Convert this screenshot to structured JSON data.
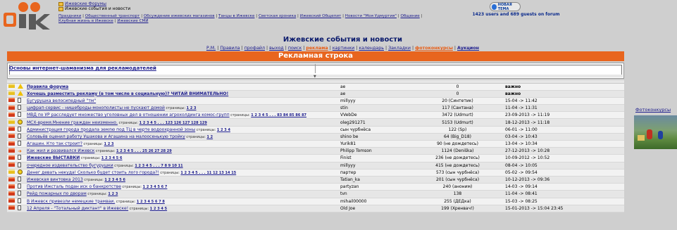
{
  "header": {
    "crumb_forum": "Ижевские Форумы",
    "crumb_section": "Ижевские события и новости",
    "new_topic": "НОВАЯ ТЕМА",
    "online": "1423 users and 689 guests on forum",
    "topnav": [
      "Праздники",
      "Общественный транспорт",
      "Обсуждение ижевских магазинов",
      "Танцы в Ижевске",
      "Светская хроника",
      "Ижевский Общепит",
      "Новости \"Моя Удмуртия\"",
      "Общение",
      "Клубная жизнь в Ижевске",
      "Ижевские СМИ"
    ]
  },
  "page_title": "Ижевские события и новости",
  "menu": {
    "items": [
      "Р.М.",
      "Правила",
      "профайл",
      "выход",
      "поиск",
      "реклама",
      "картинки",
      "календарь",
      "Закладки",
      "фотоконкурсы",
      "Аукцион"
    ]
  },
  "ad_bar": "Рекламная строка",
  "ad_box_title": "Основы интернет-шаманизма для рекламодателей",
  "pages_word": "страницы:",
  "topics": [
    {
      "icon": "warn",
      "title": "Правила форума",
      "bold": true,
      "pages": "",
      "author": "ae",
      "replies": "0",
      "last": "важно"
    },
    {
      "icon": "warn",
      "title": "Хочешь разместить рекламу (в том числе в социальную)? ЧИТАЙ ВНИМАТЕЛЬНО!",
      "bold": true,
      "pages": "",
      "author": "ae",
      "replies": "0",
      "last": "важно"
    },
    {
      "icon": "doc",
      "title": "Бугурушка велосипедный \"тм\"",
      "bold": false,
      "pages": "",
      "author": "millyyy",
      "replies": "20 (Синтетик)",
      "last": "15-04 -> 11:42"
    },
    {
      "icon": "doc",
      "title": "цифрап-сервис - нишеброды-монополисты не пускают домой",
      "bold": false,
      "pages": "1 2 3",
      "author": "stin",
      "replies": "117 (Сантана)",
      "last": "11-04 -> 11:31"
    },
    {
      "icon": "doc",
      "title": "МВД по УР расследует множество уголовных дел в отношении агрохолдинга комос-групп",
      "bold": false,
      "pages": "1 2 3 4 5 . . . 83 84 85 86 87",
      "author": "VVebDe",
      "replies": "3472 (Udmurt)",
      "last": "23-09-2013 -> 11:19"
    },
    {
      "icon": "smile",
      "title": "МСХ-время.Мнение граждан неизменно.",
      "bold": false,
      "pages": "1 2 3 4 5 . . . 123 126 127 128 129",
      "author": "oleg291271",
      "replies": "5153 (Udmurt)",
      "last": "18-12-2013 -> 11:18"
    },
    {
      "icon": "doc",
      "title": "Администрация города продала землю под ТЦ в черте водоохранной зоны",
      "bold": false,
      "pages": "1 2 3 4",
      "author": "сын чурбнёса",
      "replies": "122 (Sp)",
      "last": "06-01 -> 11:00"
    },
    {
      "icon": "doc",
      "title": "Соловьёв оценил работу Ушакова и Агашина на малоосенькую тройку",
      "bold": false,
      "pages": "1 2",
      "author": "shino be",
      "replies": "64 (Big_D18)",
      "last": "03-04 -> 10:43"
    },
    {
      "icon": "doc",
      "title": "Агашин. Кто так строит?",
      "bold": false,
      "pages": "1 2 3",
      "author": "Yurik81",
      "replies": "90 (не дождетесь)",
      "last": "13-04 -> 10:34"
    },
    {
      "icon": "arrow",
      "title": "Как жил и развивался Ижевск",
      "bold": false,
      "pages": "1 2 3 4 5 . . . 25 26 27 28 29",
      "author": "Philipp Tomson",
      "replies": "1124 (Deniška)",
      "last": "27-12-2013 -> 10:28"
    },
    {
      "icon": "doc",
      "title": "Ижевские ВЫСТАВКИ",
      "bold": true,
      "pages": "1 2 3 4 5 6",
      "author": "Finist",
      "replies": "236 (не дождетесь)",
      "last": "10-09-2012 -> 10:52"
    },
    {
      "icon": "doc",
      "title": "очередное издевательство бугурушки",
      "bold": false,
      "pages": "1 2 3 4 5 . . . 7 8 9 10 11",
      "author": "millyyy",
      "replies": "415 (не дождетесь)",
      "last": "08-04 -> 10:05"
    },
    {
      "icon": "smile",
      "title": "Денег девать некуда! Сколько будет стоить лого города?!",
      "bold": false,
      "pages": "1 2 3 4 5 . . . 11 12 13 14 15",
      "author": "партер",
      "replies": "573 (сын чурбнёса)",
      "last": "05-02 -> 09:54"
    },
    {
      "icon": "doc",
      "title": "Ижевская винтовка 2013",
      "bold": false,
      "pages": "1 2 3 4 5 6",
      "author": "Tatian_ka",
      "replies": "201 (сын чурбнёса)",
      "last": "10-12-2013 -> 09:36"
    },
    {
      "icon": "doc",
      "title": "Против Ижсталь подан иск о банкротстве",
      "bold": false,
      "pages": "1 2 3 4 5 6 7",
      "author": "partyzan",
      "replies": "240 (аноним)",
      "last": "14-03 -> 09:14"
    },
    {
      "icon": "doc",
      "title": "Рейд пожарных по дворам",
      "bold": false,
      "pages": "1 2 3",
      "author": "tvn",
      "replies": "138",
      "last": "11-04 -> 08:41"
    },
    {
      "icon": "doc",
      "title": "В Ижевск привезли немецкие трамваи.",
      "bold": false,
      "pages": "1 2 3 4 5 6 7 8",
      "author": "mihail00000",
      "replies": "255 (ДЕДка)",
      "last": "15-03 -> 08:25"
    },
    {
      "icon": "doc",
      "title": "12 Апреля - \"Тотальный диктант\" в Ижевске!",
      "bold": false,
      "pages": "1 2 3 4 5",
      "author": "Old Joe",
      "replies": "199 (Хренвач!)",
      "last": "15-01-2013 -> 15:04 23:45"
    }
  ],
  "side_link": "Фотоконкурсы",
  "colors": {
    "accent": "#e8651e",
    "link": "#1a1a8c"
  }
}
